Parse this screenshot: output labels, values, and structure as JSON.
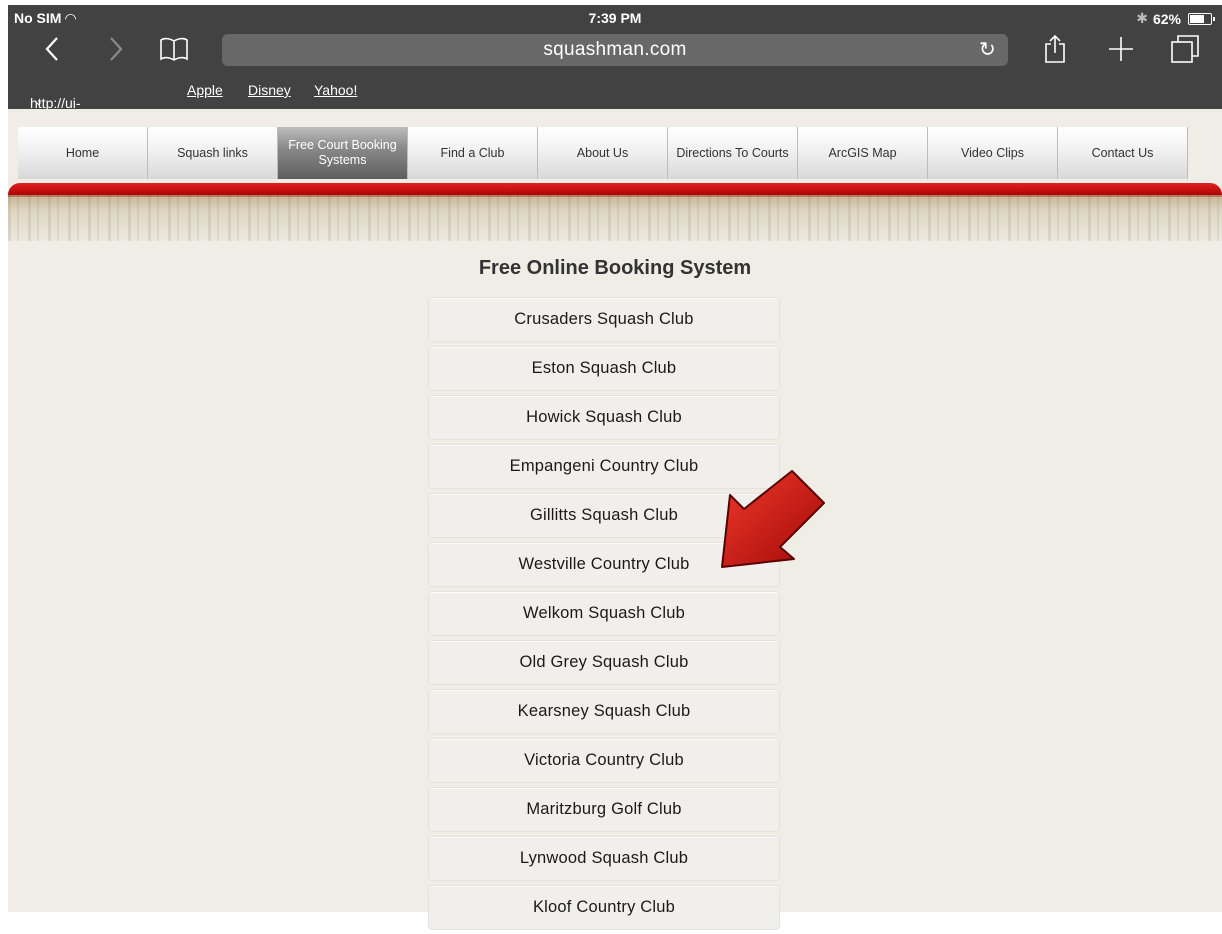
{
  "status_bar": {
    "carrier": "No SIM",
    "time": "7:39 PM",
    "battery": "62%",
    "icons": [
      "wifi-icon",
      "bluetooth-icon",
      "battery-icon"
    ]
  },
  "browser": {
    "url": "squashman.com",
    "toolbar_icons": [
      "back-icon",
      "forward-icon",
      "bookmarks-icon",
      "reload-icon",
      "share-icon",
      "new-tab-icon",
      "tabs-icon"
    ],
    "bookmarks": [
      {
        "label": "http://ui-cloud.com"
      },
      {
        "label": "Apple"
      },
      {
        "label": "Disney"
      },
      {
        "label": "Yahoo!"
      }
    ]
  },
  "nav": {
    "items": [
      {
        "label": "Home"
      },
      {
        "label": "Squash links"
      },
      {
        "label": "Free Court Booking Systems"
      },
      {
        "label": "Find a Club"
      },
      {
        "label": "About Us"
      },
      {
        "label": "Directions To Courts"
      },
      {
        "label": "ArcGIS Map"
      },
      {
        "label": "Video Clips"
      },
      {
        "label": "Contact Us"
      }
    ],
    "active": "Free Court Booking Systems"
  },
  "main": {
    "heading": "Free Online Booking System",
    "clubs": [
      {
        "label": "Crusaders Squash Club"
      },
      {
        "label": "Eston Squash Club"
      },
      {
        "label": "Howick Squash Club"
      },
      {
        "label": "Empangeni Country Club"
      },
      {
        "label": "Gillitts Squash Club"
      },
      {
        "label": "Westville Country Club"
      },
      {
        "label": "Welkom Squash Club"
      },
      {
        "label": "Old Grey Squash Club"
      },
      {
        "label": "Kearsney Squash Club"
      },
      {
        "label": "Victoria Country Club"
      },
      {
        "label": "Maritzburg Golf Club"
      },
      {
        "label": "Lynwood Squash Club"
      },
      {
        "label": "Kloof Country Club"
      }
    ],
    "annotation": "red-arrow-icon"
  },
  "colors": {
    "chrome": "#424242",
    "accent_red": "#d41414",
    "page_bg": "#efede6",
    "nav_active": "#6e6e6e"
  }
}
